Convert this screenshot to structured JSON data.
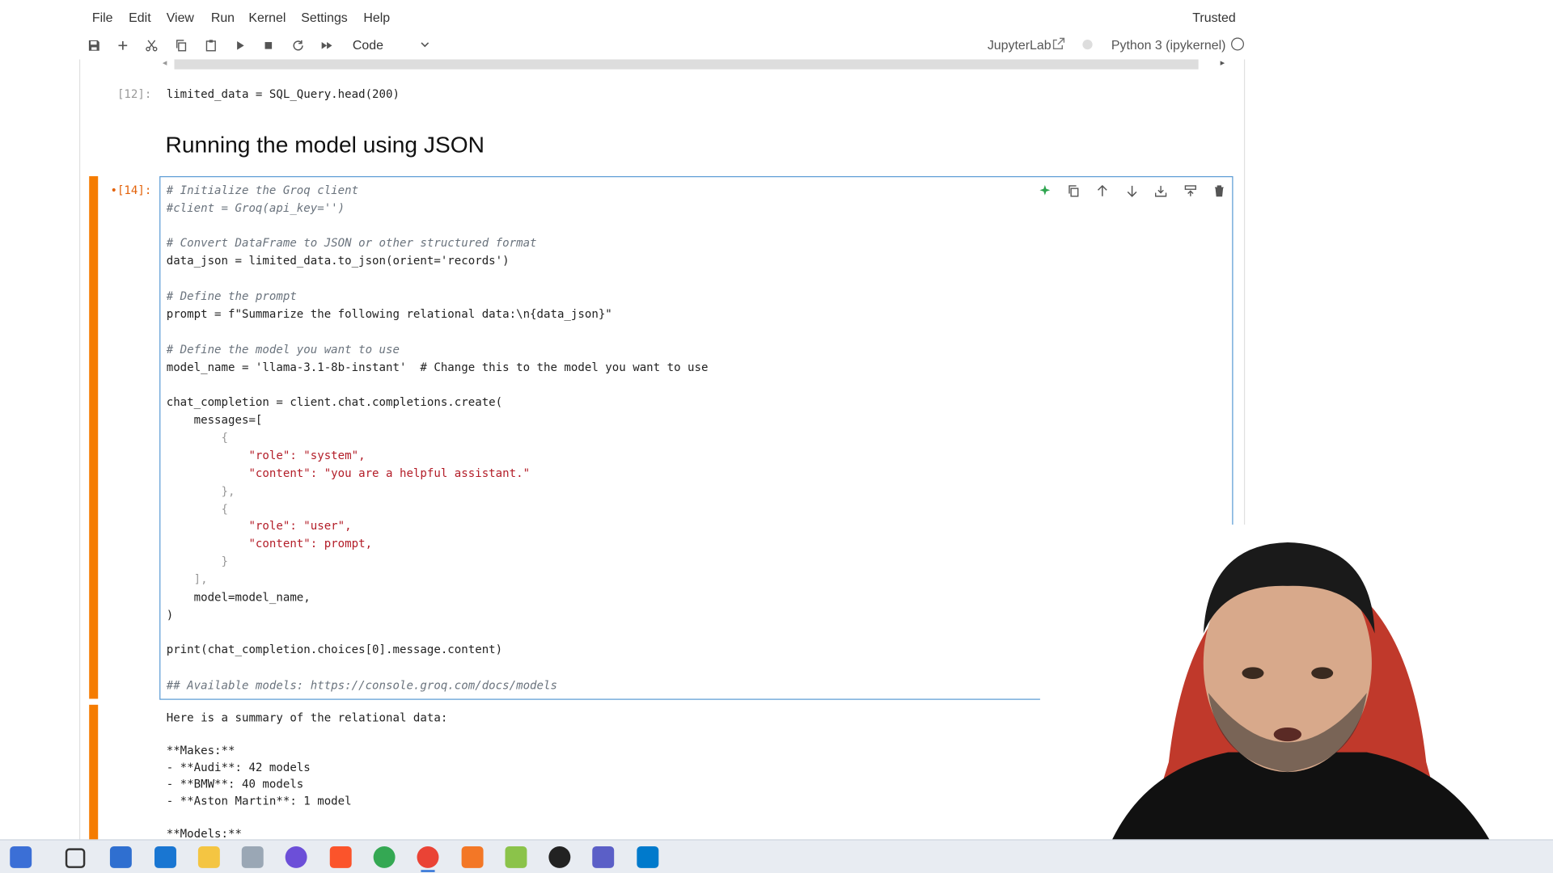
{
  "menubar": {
    "items": [
      "File",
      "Edit",
      "View",
      "Run",
      "Kernel",
      "Settings",
      "Help"
    ],
    "trusted": "Trusted"
  },
  "toolbar": {
    "cell_type": "Code",
    "jupyterlab_link": "JupyterLab",
    "kernel_name": "Python 3 (ipykernel)"
  },
  "cells": {
    "cell12": {
      "prompt": "[12]:",
      "code": "limited_data = SQL_Query.head(200)"
    },
    "markdown_heading": "Running the model using JSON",
    "cell14": {
      "prompt": "•[14]:",
      "lines": [
        "# Initialize the Groq client",
        "#client = Groq(api_key='')",
        "",
        "# Convert DataFrame to JSON or other structured format",
        "data_json = limited_data.to_json(orient='records')",
        "",
        "# Define the prompt",
        "prompt = f\"Summarize the following relational data:\\n{data_json}\"",
        "",
        "# Define the model you want to use",
        "model_name = 'llama-3.1-8b-instant'  # Change this to the model you want to use",
        "",
        "chat_completion = client.chat.completions.create(",
        "    messages=[",
        "        {",
        "            \"role\": \"system\",",
        "            \"content\": \"you are a helpful assistant.\"",
        "        },",
        "        {",
        "            \"role\": \"user\",",
        "            \"content\": prompt,",
        "        }",
        "    ],",
        "    model=model_name,",
        ")",
        "",
        "print(chat_completion.choices[0].message.content)",
        "",
        "## Available models: https://console.groq.com/docs/models"
      ]
    },
    "output14": {
      "lines": [
        "Here is a summary of the relational data:",
        "",
        "**Makes:**",
        "- **Audi**: 42 models",
        "- **BMW**: 40 models",
        "- **Aston Martin**: 1 model",
        "",
        "**Models:**"
      ]
    }
  },
  "colors": {
    "active_cell_bar": "#f57c00",
    "cell_border": "#5b9bd5",
    "comment": "#6a737d",
    "string": "#b31d28",
    "function": "#1a5fb4"
  },
  "icons": {
    "toolbar": [
      "save-icon",
      "add-cell-icon",
      "cut-icon",
      "copy-icon",
      "paste-icon",
      "run-icon",
      "stop-icon",
      "restart-icon",
      "run-all-icon"
    ],
    "cell_actions": [
      "ai-sparkle-icon",
      "duplicate-icon",
      "move-up-icon",
      "move-down-icon",
      "insert-below-icon",
      "insert-above-icon",
      "delete-icon"
    ],
    "taskbar": [
      "calendar-icon",
      "task-view-icon",
      "store-icon",
      "mail-icon",
      "file-explorer-icon",
      "notepad-icon",
      "copilot-icon",
      "brave-icon",
      "chrome-icon",
      "chrome-active-icon",
      "jupyter-icon",
      "paint-icon",
      "obs-icon",
      "teams-icon",
      "vscode-icon"
    ]
  }
}
